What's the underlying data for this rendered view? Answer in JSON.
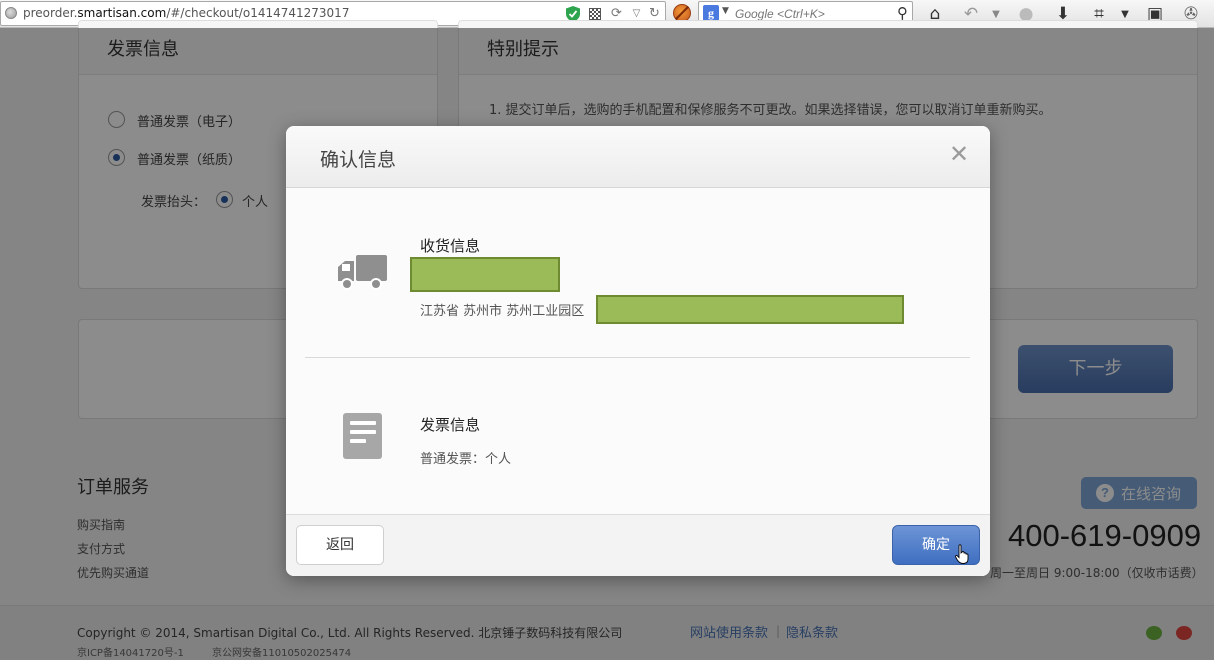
{
  "browser": {
    "url_prefix": "preorder.",
    "url_host": "smartisan.com",
    "url_path": "/#/checkout/o1414741273017",
    "search_placeholder": "Google <Ctrl+K>"
  },
  "page": {
    "invoice_panel": {
      "title": "发票信息",
      "options": [
        "普通发票（电子）",
        "普通发票（纸质）"
      ],
      "selected_option": "普通发票（纸质）",
      "header_label": "发票抬头：",
      "header_value": "个人"
    },
    "notice_panel": {
      "title": "特别提示",
      "text": "1. 提交订单后，选购的手机配置和保修服务不可更改。如果选择错误，您可以取消订单重新购买。"
    },
    "next_button": "下一步"
  },
  "footer": {
    "section_title": "订单服务",
    "links": [
      "购买指南",
      "支付方式",
      "优先购买通道"
    ],
    "consult_label": "在线咨询",
    "phone": "400-619-0909",
    "hours": "周一至周日 9:00-18:00（仅收市话费）",
    "copyright": "Copyright © 2014, Smartisan Digital Co., Ltd. All Rights Reserved. 北京锤子数码科技有限公司",
    "icp": "京ICP备14041720号-1",
    "police_record": "京公网安备11010502025474",
    "terms_link": "网站使用条款",
    "privacy_link": "隐私条款"
  },
  "modal": {
    "title": "确认信息",
    "close_symbol": "✕",
    "shipping": {
      "title": "收货信息",
      "address_prefix": "江苏省 苏州市 苏州工业园区"
    },
    "invoice": {
      "title": "发票信息",
      "value": "普通发票：个人"
    },
    "back_button": "返回",
    "confirm_button": "确定"
  },
  "colors": {
    "primary_button": "#4f7fce",
    "redaction": "#9bbb59",
    "overlay": "rgba(0,0,0,0.45)"
  }
}
